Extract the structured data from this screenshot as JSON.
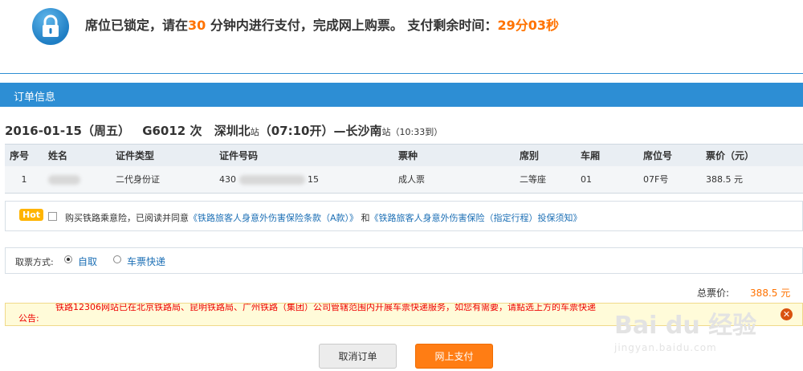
{
  "lock_banner": {
    "part1": "席位已锁定，请在",
    "minutes": "30",
    "part2": " 分钟内进行支付，完成网上购票。 支付剩余时间：",
    "remaining": "29分03秒"
  },
  "order_section": {
    "title": "订单信息"
  },
  "trip": {
    "date": "2016-01-15（周五）",
    "train": "G6012 次",
    "from_station": "深圳北",
    "from_suffix": "站",
    "depart": "（07:10开）",
    "dash": "—",
    "to_station": "长沙南",
    "to_suffix": "站",
    "arrive": "（10:33到）"
  },
  "table": {
    "headers": [
      "序号",
      "姓名",
      "证件类型",
      "证件号码",
      "票种",
      "席别",
      "车厢",
      "席位号",
      "票价（元）"
    ],
    "rows": [
      {
        "index": "1",
        "id_type": "二代身份证",
        "id_prefix": "430",
        "id_suffix": "15",
        "ticket_type": "成人票",
        "seat_class": "二等座",
        "car": "01",
        "seat": "07F号",
        "price": "388.5 元"
      }
    ]
  },
  "insurance": {
    "badge": "Hot",
    "text": "购买铁路乘意险，已阅读并同意",
    "link1": "《铁路旅客人身意外伤害保险条款（A款）》",
    "and": " 和",
    "link2": "《铁路旅客人身意外伤害保险（指定行程）投保须知》"
  },
  "delivery": {
    "label": "取票方式:",
    "option1": "自取",
    "option2": "车票快递",
    "selected": "自取"
  },
  "total": {
    "label": "总票价:",
    "amount": "388.5 元"
  },
  "notice": {
    "label": "公告:",
    "message": "铁路12306网站已在北京铁路局、昆明铁路局、广州铁路（集团）公司管辖范围内开展车票快递服务，如您有需要，请點选上方的车票快递"
  },
  "buttons": {
    "cancel": "取消订单",
    "pay": "网上支付"
  },
  "colors": {
    "accent_blue": "#2d8ed4",
    "accent_orange": "#ff7200",
    "notice_red": "#e00000"
  }
}
